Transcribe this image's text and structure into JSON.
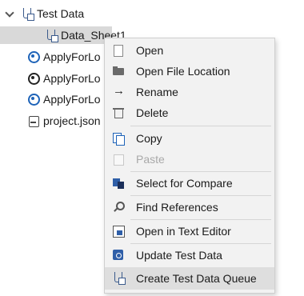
{
  "tree": {
    "root": {
      "label": "Test Data",
      "icon": "test-data-flask-icon",
      "expanded": true
    },
    "selected_item": {
      "label": "Data_Sheet1",
      "icon": "data-sheet-flask-icon"
    },
    "items": [
      {
        "label": "ApplyForLo",
        "icon": "action-circle-blue-icon"
      },
      {
        "label": "ApplyForLo",
        "icon": "action-circle-black-icon"
      },
      {
        "label": "ApplyForLo",
        "icon": "action-circle-blue-icon"
      },
      {
        "label": "project.json",
        "icon": "json-file-icon"
      }
    ]
  },
  "context_menu": {
    "items": [
      {
        "label": "Open",
        "icon": "open-icon",
        "enabled": true
      },
      {
        "label": "Open File Location",
        "icon": "folder-icon",
        "enabled": true
      },
      {
        "label": "Rename",
        "icon": "rename-arrow-icon",
        "enabled": true
      },
      {
        "label": "Delete",
        "icon": "trash-icon",
        "enabled": true
      },
      {
        "label": "Copy",
        "icon": "copy-icon",
        "enabled": true
      },
      {
        "label": "Paste",
        "icon": "paste-icon",
        "enabled": false
      },
      {
        "label": "Select for Compare",
        "icon": "compare-icon",
        "enabled": true
      },
      {
        "label": "Find References",
        "icon": "find-references-icon",
        "enabled": true
      },
      {
        "label": "Open in Text Editor",
        "icon": "text-editor-icon",
        "enabled": true
      },
      {
        "label": "Update Test Data",
        "icon": "update-test-data-icon",
        "enabled": true
      },
      {
        "label": "Create Test Data Queue",
        "icon": "test-data-queue-icon",
        "enabled": true,
        "highlighted": true
      }
    ]
  },
  "colors": {
    "selection": "#d9d9d9",
    "menu_bg": "#f2f2f2",
    "accent": "#1e63b8"
  }
}
